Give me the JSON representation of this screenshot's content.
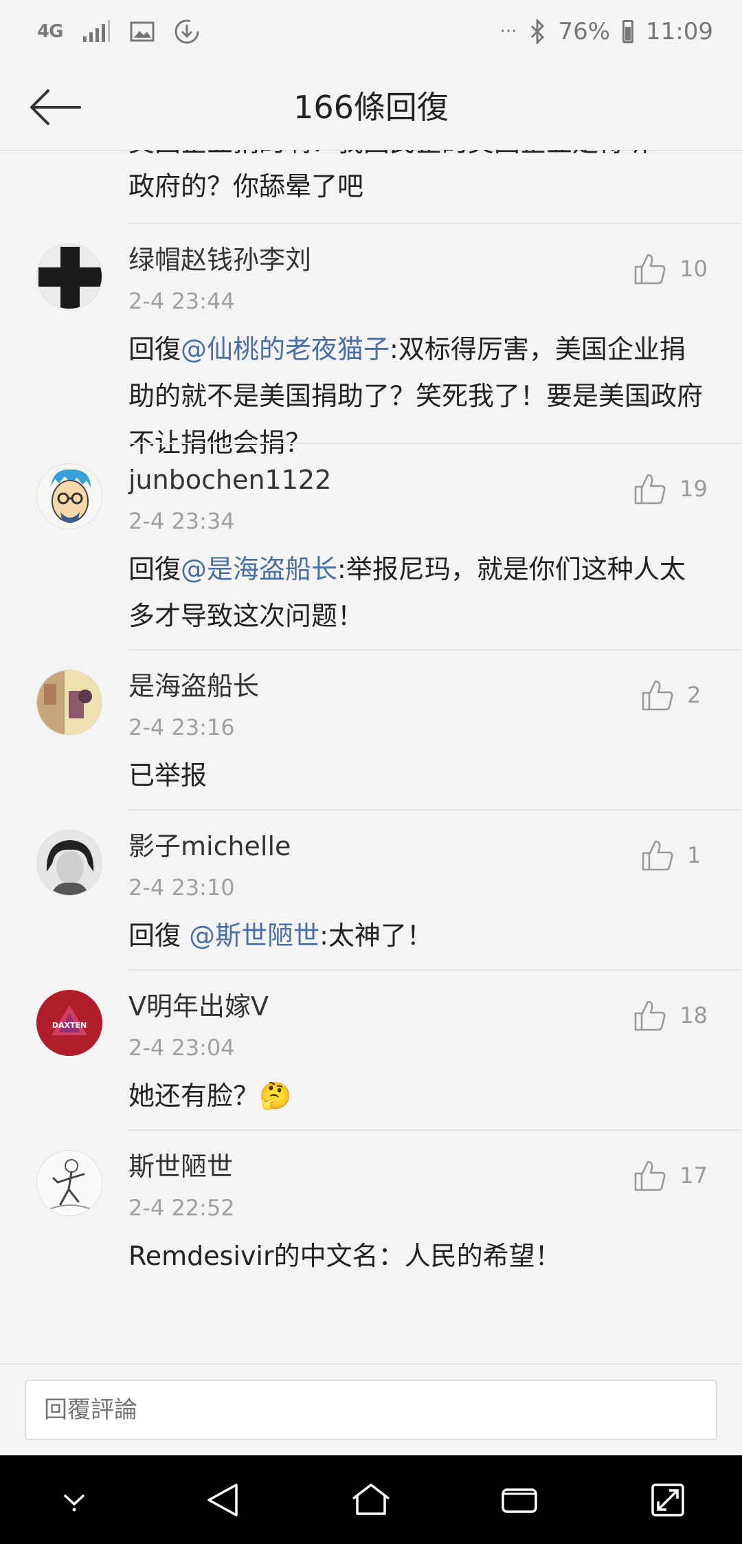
{
  "status_bar": {
    "network": "4G",
    "dots": "···",
    "battery": "76%",
    "time": "11:09"
  },
  "header": {
    "title": "166條回復"
  },
  "partial_comment": {
    "line1": "美国企业捐的啊？我国民企的美国企业是得听",
    "line2": "政府的？你舔晕了吧"
  },
  "comments": [
    {
      "username": "绿帽赵钱孙李刘",
      "time": "2-4 23:44",
      "likes": "10",
      "prefix": "回復",
      "mention": "@仙桃的老夜猫子",
      "text": ":双标得厉害，美国企业捐助的就不是美国捐助了？笑死我了！要是美国政府不让捐他会捐？"
    },
    {
      "username": "junbochen1122",
      "time": "2-4 23:34",
      "likes": "19",
      "prefix": "回復",
      "mention": "@是海盗船长",
      "text": ":举报尼玛，就是你们这种人太多才导致这次问题！"
    },
    {
      "username": "是海盗船长",
      "time": "2-4 23:16",
      "likes": "2",
      "prefix": "",
      "mention": "",
      "text": "已举报"
    },
    {
      "username": "影子michelle",
      "time": "2-4 23:10",
      "likes": "1",
      "prefix": "回復 ",
      "mention": "@斯世陋世",
      "text": ":太神了！"
    },
    {
      "username": "V明年出嫁V",
      "time": "2-4 23:04",
      "likes": "18",
      "prefix": "",
      "mention": "",
      "text": "她还有脸？",
      "emoji": "🤔"
    },
    {
      "username": "斯世陋世",
      "time": "2-4 22:52",
      "likes": "17",
      "prefix": "",
      "mention": "",
      "text": "Remdesivir的中文名：人民的希望！"
    }
  ],
  "reply_box": {
    "placeholder": "回覆評論"
  },
  "avatar_texts": {
    "daxten": "DAXTEN"
  },
  "colors": {
    "mention": "#4a6fa5",
    "background": "#f4f4f4",
    "nav_bar": "#000000"
  }
}
